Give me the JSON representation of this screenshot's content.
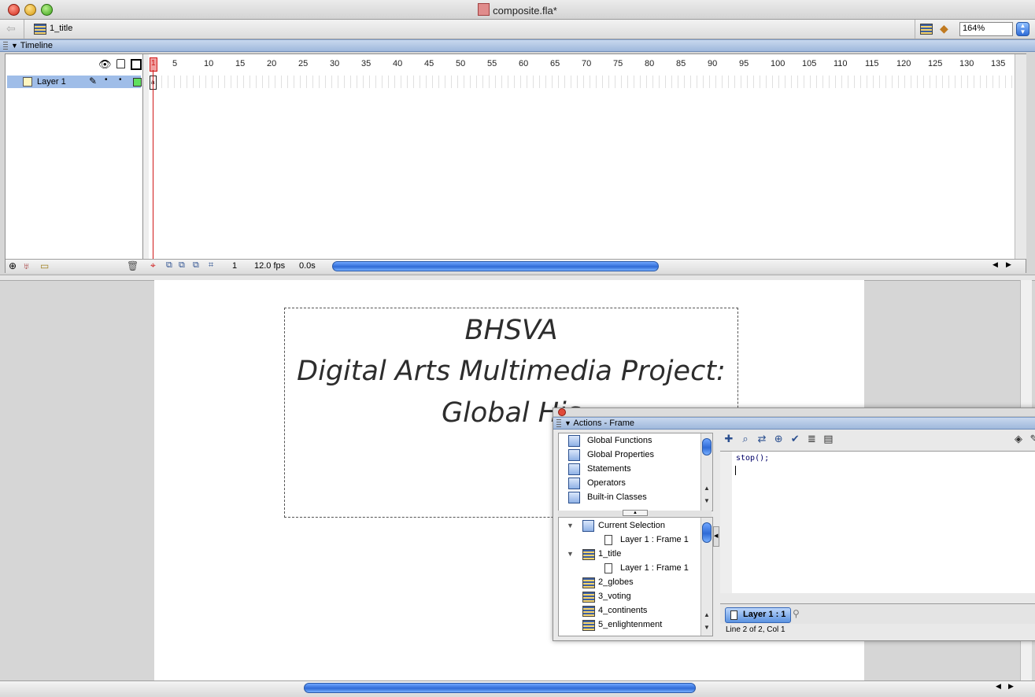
{
  "window": {
    "title": "composite.fla*"
  },
  "editbar": {
    "scene_name": "1_title",
    "zoom": "164%"
  },
  "timeline": {
    "header": "Timeline",
    "layer_name": "Layer 1",
    "ruler": [
      "1",
      "5",
      "10",
      "15",
      "20",
      "25",
      "30",
      "35",
      "40",
      "45",
      "50",
      "55",
      "60",
      "65",
      "70",
      "75",
      "80",
      "85",
      "90",
      "95",
      "100",
      "105",
      "110",
      "115",
      "120",
      "125",
      "130",
      "135"
    ],
    "current_frame": "1",
    "fps": "12.0 fps",
    "elapsed": "0.0s"
  },
  "stage": {
    "line1": "BHSVA",
    "line2": "Digital Arts Multimedia Project:",
    "line3": "Global His"
  },
  "actions": {
    "header": "Actions - Frame",
    "toolbox": [
      "Global Functions",
      "Global Properties",
      "Statements",
      "Operators",
      "Built-in Classes"
    ],
    "navigator": [
      {
        "label": "Current Selection",
        "kind": "book",
        "indent": 0,
        "expanded": true
      },
      {
        "label": "Layer 1 : Frame 1",
        "kind": "page",
        "indent": 1
      },
      {
        "label": "1_title",
        "kind": "scene",
        "indent": 0,
        "expanded": true
      },
      {
        "label": "Layer 1 : Frame 1",
        "kind": "page",
        "indent": 1
      },
      {
        "label": "2_globes",
        "kind": "scene",
        "indent": 0
      },
      {
        "label": "3_voting",
        "kind": "scene",
        "indent": 0
      },
      {
        "label": "4_continents",
        "kind": "scene",
        "indent": 0
      },
      {
        "label": "5_enlightenment",
        "kind": "scene",
        "indent": 0
      }
    ],
    "code": "stop();",
    "tab_label": "Layer 1 : 1",
    "status": "Line 2 of 2, Col 1"
  },
  "colors": {
    "accent": "#2f6bd6",
    "playhead": "#d01818",
    "panel_header": "#a9c1e4"
  }
}
